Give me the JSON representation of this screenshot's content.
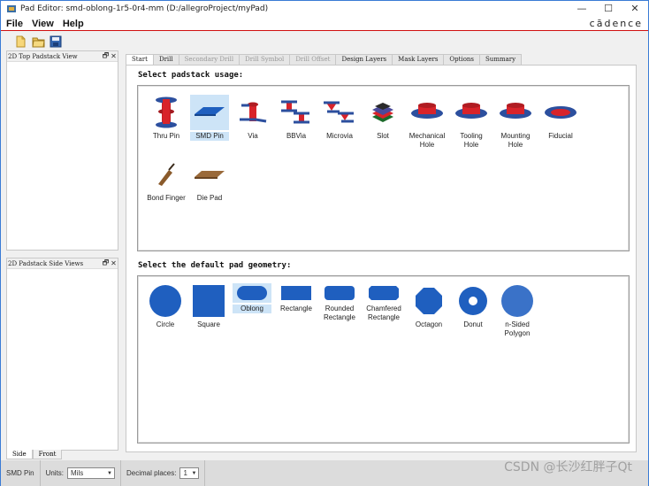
{
  "window": {
    "title": "Pad Editor: smd-oblong-1r5-0r4-mm  (D:/allegroProject/myPad)",
    "minimize": "—",
    "maximize": "☐",
    "close": "✕"
  },
  "menu": {
    "items": [
      "File",
      "View",
      "Help"
    ],
    "brand": "cādence"
  },
  "toolbar": {
    "buttons": [
      "new-icon",
      "open-icon",
      "save-icon"
    ]
  },
  "panels": {
    "top_view": {
      "title": "2D Top Padstack View",
      "float": "🗗",
      "close": "✕"
    },
    "side_view": {
      "title": "2D Padstack Side Views",
      "float": "🗗",
      "close": "✕"
    },
    "side_tabs": [
      "Side",
      "Front"
    ]
  },
  "tabs": [
    {
      "label": "Start",
      "state": "active"
    },
    {
      "label": "Drill",
      "state": "normal"
    },
    {
      "label": "Secondary Drill",
      "state": "disabled"
    },
    {
      "label": "Drill Symbol",
      "state": "disabled"
    },
    {
      "label": "Drill Offset",
      "state": "disabled"
    },
    {
      "label": "Design Layers",
      "state": "normal"
    },
    {
      "label": "Mask Layers",
      "state": "normal"
    },
    {
      "label": "Options",
      "state": "normal"
    },
    {
      "label": "Summary",
      "state": "normal"
    }
  ],
  "usage": {
    "title": "Select padstack usage:",
    "selected": "SMD Pin",
    "items": [
      "Thru Pin",
      "SMD Pin",
      "Via",
      "BBVia",
      "Microvia",
      "Slot",
      "Mechanical Hole",
      "Tooling Hole",
      "Mounting Hole",
      "Fiducial",
      "Bond Finger",
      "Die Pad"
    ]
  },
  "geometry": {
    "title": "Select the default pad geometry:",
    "selected": "Oblong",
    "items": [
      "Circle",
      "Square",
      "Oblong",
      "Rectangle",
      "Rounded Rectangle",
      "Chamfered Rectangle",
      "Octagon",
      "Donut",
      "n-Sided Polygon"
    ]
  },
  "status": {
    "mode": "SMD Pin",
    "units_label": "Units:",
    "units_value": "Mils",
    "decimal_label": "Decimal places:",
    "decimal_value": "1"
  },
  "watermark": "CSDN @长沙红胖子Qt",
  "colors": {
    "pad_blue": "#1f5fbf",
    "copper_red": "#d8232a",
    "selection": "#cde4f7",
    "accent_line": "#d01010"
  }
}
